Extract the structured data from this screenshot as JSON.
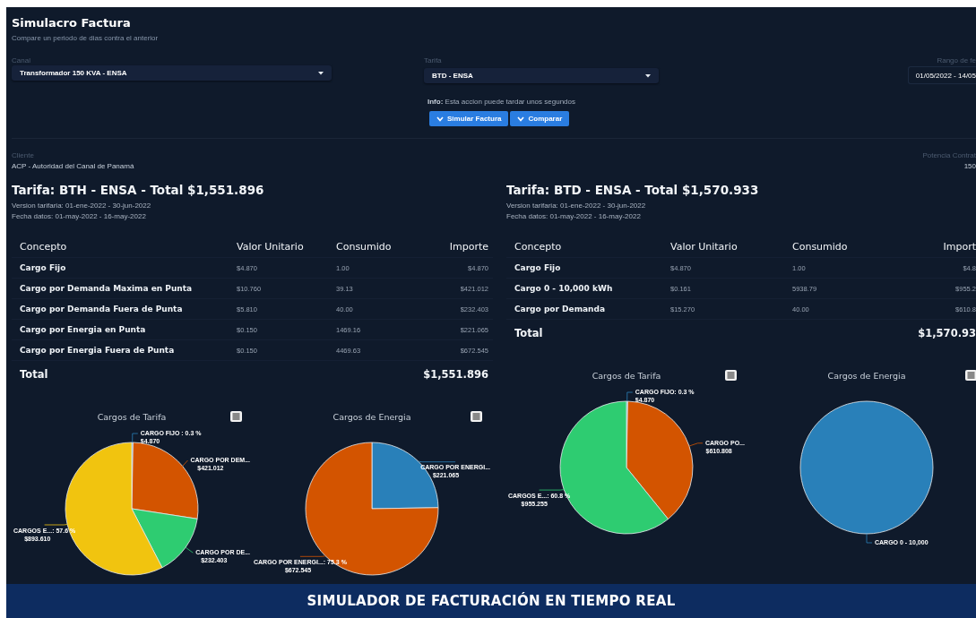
{
  "header": {
    "title": "Simulacro Factura",
    "subtitle": "Compare un periodo de dias contra el anterior"
  },
  "filters": {
    "canal": {
      "label": "Canal",
      "value": "Transformador 150 KVA - ENSA"
    },
    "tarifa": {
      "label": "Tarifa",
      "value": "BTD - ENSA"
    },
    "date_range": {
      "label": "Rango de fe",
      "value": "01/05/2022 - 14/05"
    }
  },
  "info": {
    "text": "**Info:** Esta accion puede tardar unos segundos"
  },
  "buttons": [
    {
      "label": "Simular Factura"
    },
    {
      "label": "Comparar"
    }
  ],
  "client": {
    "label": "Cliente",
    "value": "ACP - Autoridad del Canal de Panamá"
  },
  "contracted_power": {
    "label": "Potencia Contrat",
    "value": "150"
  },
  "comparisons": [
    {
      "heading": "Tarifa: BTH - ENSA - Total $1,551.896",
      "version": "Version tarifaria: 01-ene-2022 - 30-jun-2022",
      "data_dates": "Fecha datos: 01-may-2022 - 16-may-2022",
      "table": {
        "columns": [
          "Concepto",
          "Valor Unitario",
          "Consumido",
          "Importe"
        ],
        "rows": [
          [
            "Cargo Fijo",
            "$4.870",
            "1.00",
            "$4.870"
          ],
          [
            "Cargo por Demanda Maxima en Punta",
            "$10.760",
            "39.13",
            "$421.012"
          ],
          [
            "Cargo por Demanda Fuera de Punta",
            "$5.810",
            "40.00",
            "$232.403"
          ],
          [
            "Cargo por Energia en Punta",
            "$0.150",
            "1469.16",
            "$221.065"
          ],
          [
            "Cargo por Energia Fuera de Punta",
            "$0.150",
            "4469.63",
            "$672.545"
          ]
        ],
        "total": {
          "label": "Total",
          "value": "$1,551.896"
        }
      },
      "charts": [
        {
          "chart_data": {
            "type": "pie",
            "title": "Cargos de Tarifa",
            "categories": [
              "CARGO FIJO : 0.3 %",
              "CARGO POR DEM...",
              "CARGO POR DE...",
              "CARGOS E...: 57.6 %"
            ],
            "values": [
              4.87,
              421.012,
              232.403,
              893.61
            ],
            "colors": [
              "#2980b9",
              "#d35400",
              "#2ecc71",
              "#f1c40f"
            ],
            "value_labels": [
              "$4.870",
              "$421.012",
              "$232.403",
              "$893.610"
            ]
          }
        },
        {
          "chart_data": {
            "type": "pie",
            "title": "Cargos de Energia",
            "categories": [
              "CARGO POR ENERGI...",
              "CARGO POR ENERGI...: 75.3 %"
            ],
            "values": [
              221.065,
              672.545
            ],
            "colors": [
              "#2980b9",
              "#d35400"
            ],
            "value_labels": [
              "$221.065",
              "$672.545"
            ]
          }
        }
      ]
    },
    {
      "heading": "Tarifa: BTD - ENSA - Total $1,570.933",
      "version": "Version tarifaria: 01-ene-2022 - 30-jun-2022",
      "data_dates": "Fecha datos: 01-may-2022 - 16-may-2022",
      "table": {
        "columns": [
          "Concepto",
          "Valor Unitario",
          "Consumido",
          "Import"
        ],
        "rows": [
          [
            "Cargo Fijo",
            "$4.870",
            "1.00",
            "$4.8"
          ],
          [
            "Cargo 0 - 10,000 kWh",
            "$0.161",
            "5938.79",
            "$955.2"
          ],
          [
            "Cargo por Demanda",
            "$15.270",
            "40.00",
            "$610.8"
          ]
        ],
        "total": {
          "label": "Total",
          "value": "$1,570.93"
        }
      },
      "charts": [
        {
          "chart_data": {
            "type": "pie",
            "title": "Cargos de Tarifa",
            "categories": [
              "CARGO FIJO: 0.3 %",
              "CARGO PO...",
              "CARGOS E...: 60.8 %"
            ],
            "values": [
              4.87,
              610.808,
              955.255
            ],
            "colors": [
              "#2980b9",
              "#d35400",
              "#2ecc71"
            ],
            "value_labels": [
              "$4.870",
              "$610.808",
              "$955.255"
            ]
          }
        },
        {
          "chart_data": {
            "type": "pie",
            "title": "Cargos de Energia",
            "categories": [
              "CARGO 0 - 10,000"
            ],
            "values": [
              100
            ],
            "colors": [
              "#2980b9"
            ]
          }
        }
      ]
    }
  ],
  "banner": {
    "text": "SIMULADOR DE FACTURACIÓN EN TIEMPO REAL"
  }
}
